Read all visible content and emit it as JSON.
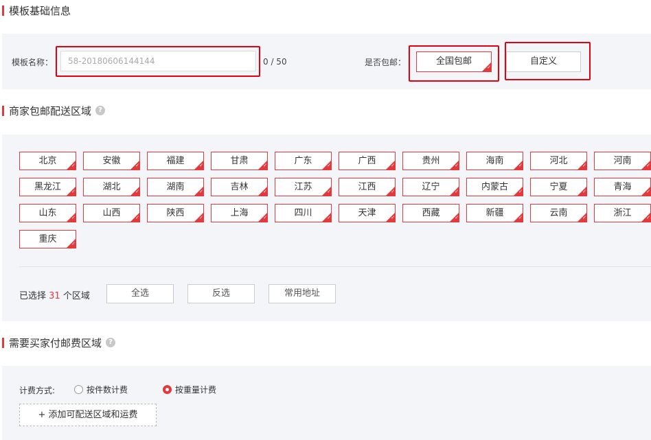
{
  "basic": {
    "title": "模板基础信息",
    "name_label": "模板名称：",
    "name_value": "58-20180606144144",
    "name_counter": "0 / 50",
    "free_label": "是否包邮：",
    "opt_free_all": "全国包邮",
    "opt_custom": "自定义"
  },
  "free_area": {
    "title": "商家包邮配送区域",
    "help": "?",
    "regions": [
      "北京",
      "安徽",
      "福建",
      "甘肃",
      "广东",
      "广西",
      "贵州",
      "海南",
      "河北",
      "河南",
      "黑龙江",
      "湖北",
      "湖南",
      "吉林",
      "江苏",
      "江西",
      "辽宁",
      "内蒙古",
      "宁夏",
      "青海",
      "山东",
      "山西",
      "陕西",
      "上海",
      "四川",
      "天津",
      "西藏",
      "新疆",
      "云南",
      "浙江",
      "重庆"
    ],
    "selected_prefix": "已选择 ",
    "selected_count": "31",
    "selected_suffix": " 个区域",
    "btn_all": "全选",
    "btn_invert": "反选",
    "btn_common": "常用地址"
  },
  "paid_area": {
    "title": "需要买家付邮费区域",
    "help": "?",
    "method_label": "计费方式:",
    "by_piece": "按件数计费",
    "by_weight": "按重量计费",
    "selected_method": "by_weight",
    "add_btn": "+ 添加可配送区域和运费"
  },
  "colors": {
    "accent": "#e4393c",
    "panel_bg": "#f3f5f8",
    "highlight": "#e4000f"
  }
}
